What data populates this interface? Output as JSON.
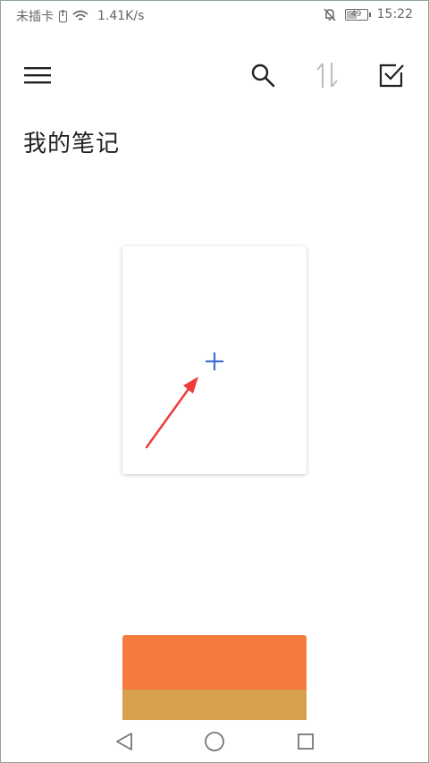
{
  "status_bar": {
    "carrier": "未插卡",
    "network_speed": "1.41K/s",
    "battery_level": "49",
    "time": "15:22"
  },
  "toolbar": {
    "menu_icon": "hamburger-menu-icon",
    "search_icon": "search-icon",
    "sort_icon": "sort-icon",
    "select_icon": "checkbox-select-icon"
  },
  "page": {
    "title": "我的笔记"
  },
  "new_note_card": {
    "icon": "plus-icon",
    "accent_color": "#3f6fd8"
  },
  "notebook_card": {
    "top_color": "#f47b3e",
    "band_color": "#d8a04e"
  },
  "annotation": {
    "arrow_color": "#f03b3b"
  },
  "nav_bar": {
    "back_icon": "back-triangle-icon",
    "home_icon": "home-circle-icon",
    "recent_icon": "recent-square-icon"
  }
}
